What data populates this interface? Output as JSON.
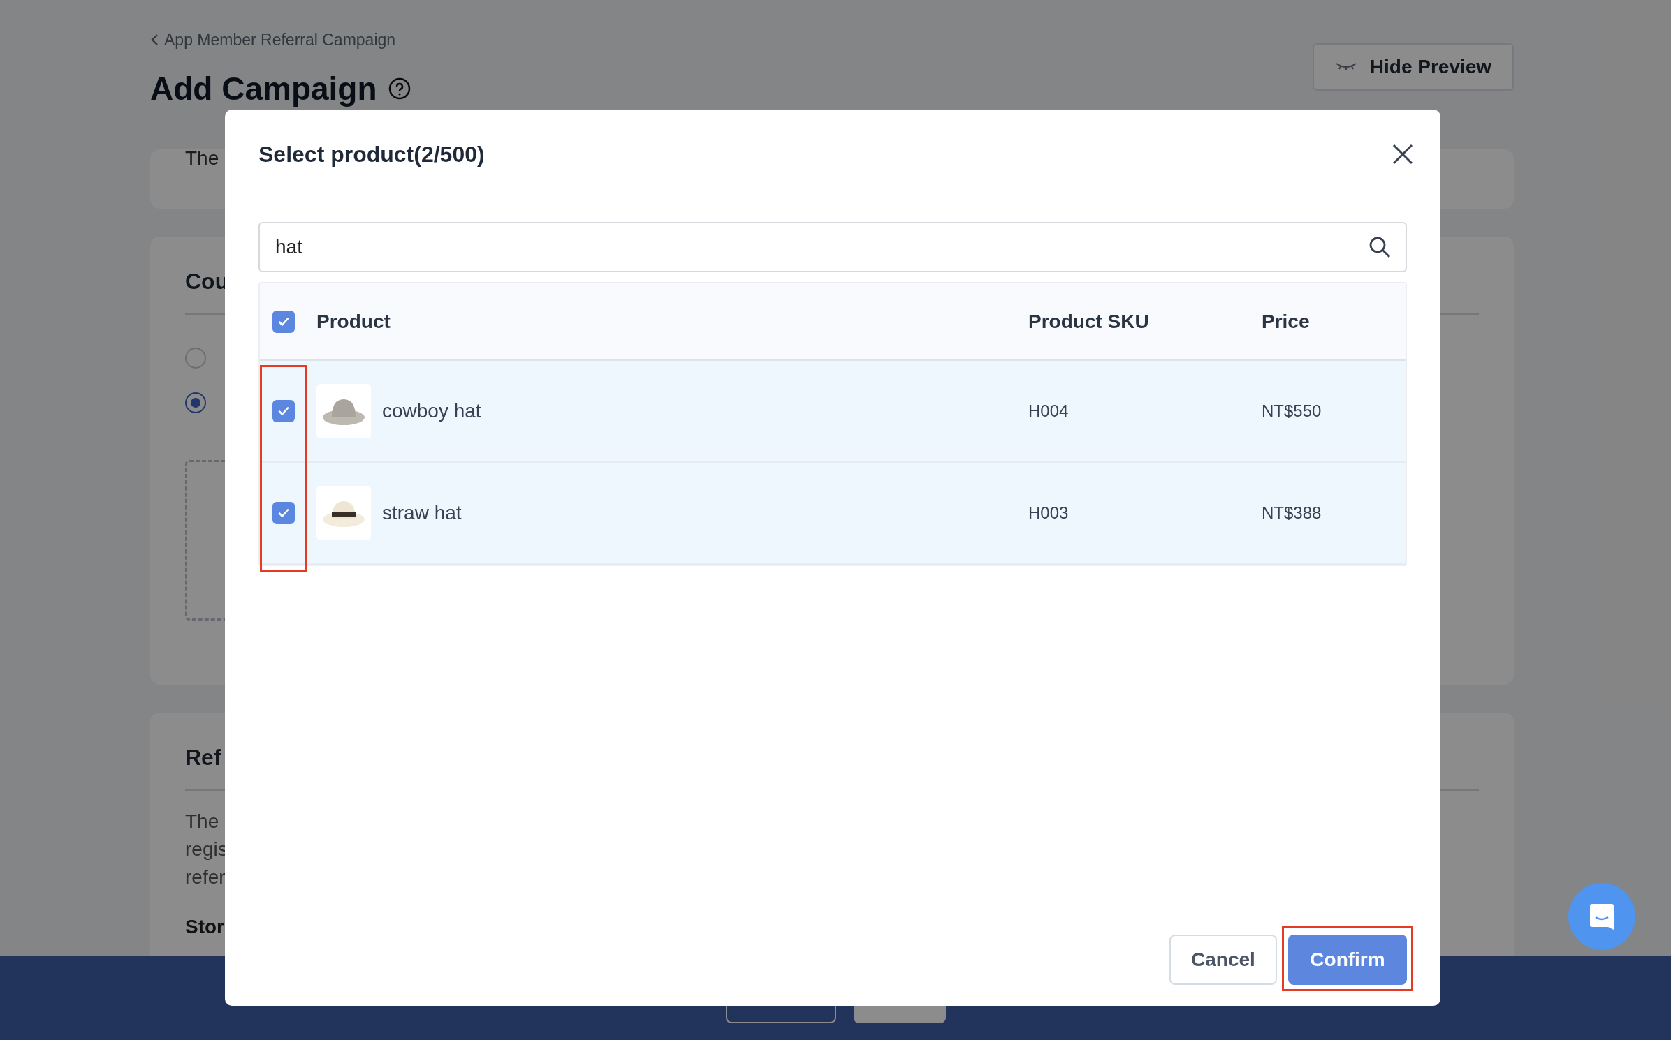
{
  "page": {
    "breadcrumb": "App Member Referral Campaign",
    "title": "Add Campaign",
    "hide_preview_button": "Hide Preview"
  },
  "background_cards": [
    {
      "lines": [
        "The"
      ]
    },
    {
      "heading": "Cou",
      "radio_options": [
        {
          "selected": false
        },
        {
          "selected": true
        }
      ]
    },
    {
      "heading": "Ref",
      "lines": [
        "The",
        "regis",
        "refer"
      ],
      "subheading": "Stor"
    }
  ],
  "dialog": {
    "title": "Select product(2/500)",
    "search": {
      "value": "hat"
    },
    "table": {
      "select_all_checked": true,
      "columns": [
        "Product",
        "Product SKU",
        "Price"
      ],
      "rows": [
        {
          "checked": true,
          "product": "cowboy hat",
          "sku": "H004",
          "price": "NT$550"
        },
        {
          "checked": true,
          "product": "straw hat",
          "sku": "H003",
          "price": "NT$388"
        }
      ]
    },
    "buttons": [
      {
        "label": "Cancel",
        "kind": "secondary"
      },
      {
        "label": "Confirm",
        "kind": "primary"
      }
    ]
  }
}
